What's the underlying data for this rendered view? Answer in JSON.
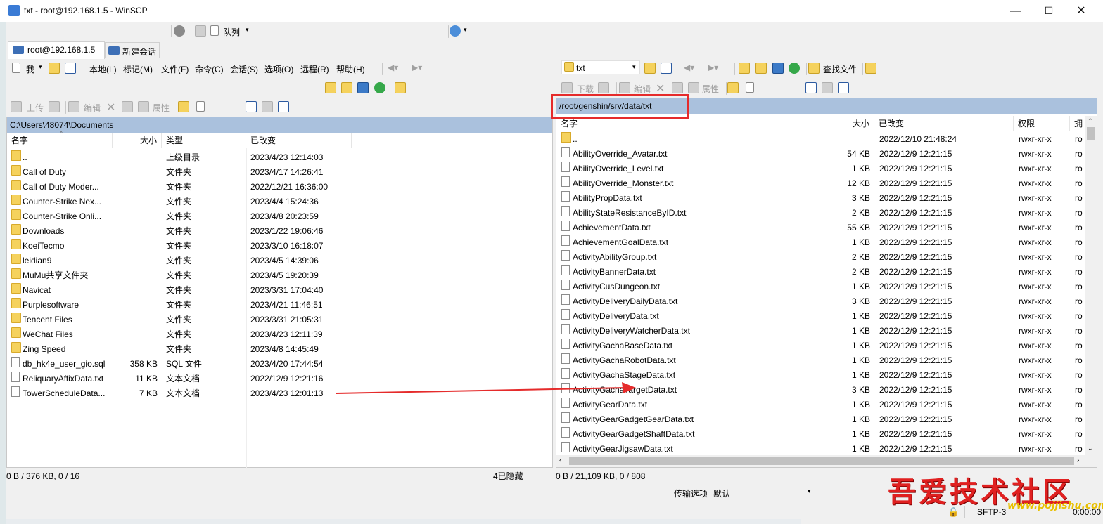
{
  "window": {
    "title": "txt - root@192.168.1.5 - WinSCP",
    "minimize": "—",
    "maximize": "☐",
    "close": "✕"
  },
  "top_toolbar": {
    "queue_label": "队列"
  },
  "tabs": [
    {
      "label": "root@192.168.1.5"
    },
    {
      "label": "新建会话"
    }
  ],
  "menu": {
    "local_dropdown": "我",
    "items": [
      "本地(L)",
      "标记(M)",
      "文件(F)",
      "命令(C)",
      "会话(S)",
      "选项(O)",
      "远程(R)",
      "帮助(H)"
    ]
  },
  "left_panel": {
    "actions": {
      "upload": "上传",
      "edit": "编辑",
      "properties": "属性"
    },
    "path": "C:\\Users\\48074\\Documents",
    "columns": [
      "名字",
      "大小",
      "类型",
      "已改变"
    ],
    "files": [
      {
        "name": "..",
        "size": "",
        "type": "上级目录",
        "modified": "2023/4/23  12:14:03",
        "icon": "up"
      },
      {
        "name": "Call of Duty",
        "size": "",
        "type": "文件夹",
        "modified": "2023/4/17  14:26:41",
        "icon": "folder"
      },
      {
        "name": "Call of Duty Moder...",
        "size": "",
        "type": "文件夹",
        "modified": "2022/12/21  16:36:00",
        "icon": "folder"
      },
      {
        "name": "Counter-Strike Nex...",
        "size": "",
        "type": "文件夹",
        "modified": "2023/4/4  15:24:36",
        "icon": "folder"
      },
      {
        "name": "Counter-Strike Onli...",
        "size": "",
        "type": "文件夹",
        "modified": "2023/4/8  20:23:59",
        "icon": "folder"
      },
      {
        "name": "Downloads",
        "size": "",
        "type": "文件夹",
        "modified": "2023/1/22  19:06:46",
        "icon": "folder"
      },
      {
        "name": "KoeiTecmo",
        "size": "",
        "type": "文件夹",
        "modified": "2023/3/10  16:18:07",
        "icon": "folder"
      },
      {
        "name": "leidian9",
        "size": "",
        "type": "文件夹",
        "modified": "2023/4/5  14:39:06",
        "icon": "folder"
      },
      {
        "name": "MuMu共享文件夹",
        "size": "",
        "type": "文件夹",
        "modified": "2023/4/5  19:20:39",
        "icon": "folder"
      },
      {
        "name": "Navicat",
        "size": "",
        "type": "文件夹",
        "modified": "2023/3/31  17:04:40",
        "icon": "folder"
      },
      {
        "name": "Purplesoftware",
        "size": "",
        "type": "文件夹",
        "modified": "2023/4/21  11:46:51",
        "icon": "folder"
      },
      {
        "name": "Tencent Files",
        "size": "",
        "type": "文件夹",
        "modified": "2023/3/31  21:05:31",
        "icon": "folder"
      },
      {
        "name": "WeChat Files",
        "size": "",
        "type": "文件夹",
        "modified": "2023/4/23  12:11:39",
        "icon": "folder"
      },
      {
        "name": "Zing Speed",
        "size": "",
        "type": "文件夹",
        "modified": "2023/4/8  14:45:49",
        "icon": "folder"
      },
      {
        "name": "db_hk4e_user_gio.sql",
        "size": "358 KB",
        "type": "SQL 文件",
        "modified": "2023/4/20  17:44:54",
        "icon": "doc"
      },
      {
        "name": "ReliquaryAffixData.txt",
        "size": "11 KB",
        "type": "文本文档",
        "modified": "2022/12/9  12:21:16",
        "icon": "doc"
      },
      {
        "name": "TowerScheduleData...",
        "size": "7 KB",
        "type": "文本文档",
        "modified": "2023/4/23  12:01:13",
        "icon": "doc"
      }
    ],
    "status": "0 B / 376 KB,  0 / 16",
    "hidden": "4已隐藏"
  },
  "right_panel": {
    "dir_dropdown": "txt",
    "find_files": "查找文件",
    "actions": {
      "download": "下载",
      "edit": "编辑",
      "properties": "属性"
    },
    "path": "/root/genshin/srv/data/txt",
    "columns": [
      "名字",
      "大小",
      "已改变",
      "权限",
      "拥"
    ],
    "files": [
      {
        "name": "..",
        "size": "",
        "modified": "2022/12/10 21:48:24",
        "perm": "rwxr-xr-x",
        "owner": "ro",
        "icon": "up"
      },
      {
        "name": "AbilityOverride_Avatar.txt",
        "size": "54 KB",
        "modified": "2022/12/9 12:21:15",
        "perm": "rwxr-xr-x",
        "owner": "ro",
        "icon": "doc"
      },
      {
        "name": "AbilityOverride_Level.txt",
        "size": "1 KB",
        "modified": "2022/12/9 12:21:15",
        "perm": "rwxr-xr-x",
        "owner": "ro",
        "icon": "doc"
      },
      {
        "name": "AbilityOverride_Monster.txt",
        "size": "12 KB",
        "modified": "2022/12/9 12:21:15",
        "perm": "rwxr-xr-x",
        "owner": "ro",
        "icon": "doc"
      },
      {
        "name": "AbilityPropData.txt",
        "size": "3 KB",
        "modified": "2022/12/9 12:21:15",
        "perm": "rwxr-xr-x",
        "owner": "ro",
        "icon": "doc"
      },
      {
        "name": "AbilityStateResistanceByID.txt",
        "size": "2 KB",
        "modified": "2022/12/9 12:21:15",
        "perm": "rwxr-xr-x",
        "owner": "ro",
        "icon": "doc"
      },
      {
        "name": "AchievementData.txt",
        "size": "55 KB",
        "modified": "2022/12/9 12:21:15",
        "perm": "rwxr-xr-x",
        "owner": "ro",
        "icon": "doc"
      },
      {
        "name": "AchievementGoalData.txt",
        "size": "1 KB",
        "modified": "2022/12/9 12:21:15",
        "perm": "rwxr-xr-x",
        "owner": "ro",
        "icon": "doc"
      },
      {
        "name": "ActivityAbilityGroup.txt",
        "size": "2 KB",
        "modified": "2022/12/9 12:21:15",
        "perm": "rwxr-xr-x",
        "owner": "ro",
        "icon": "doc"
      },
      {
        "name": "ActivityBannerData.txt",
        "size": "2 KB",
        "modified": "2022/12/9 12:21:15",
        "perm": "rwxr-xr-x",
        "owner": "ro",
        "icon": "doc"
      },
      {
        "name": "ActivityCusDungeon.txt",
        "size": "1 KB",
        "modified": "2022/12/9 12:21:15",
        "perm": "rwxr-xr-x",
        "owner": "ro",
        "icon": "doc"
      },
      {
        "name": "ActivityDeliveryDailyData.txt",
        "size": "3 KB",
        "modified": "2022/12/9 12:21:15",
        "perm": "rwxr-xr-x",
        "owner": "ro",
        "icon": "doc"
      },
      {
        "name": "ActivityDeliveryData.txt",
        "size": "1 KB",
        "modified": "2022/12/9 12:21:15",
        "perm": "rwxr-xr-x",
        "owner": "ro",
        "icon": "doc"
      },
      {
        "name": "ActivityDeliveryWatcherData.txt",
        "size": "1 KB",
        "modified": "2022/12/9 12:21:15",
        "perm": "rwxr-xr-x",
        "owner": "ro",
        "icon": "doc"
      },
      {
        "name": "ActivityGachaBaseData.txt",
        "size": "1 KB",
        "modified": "2022/12/9 12:21:15",
        "perm": "rwxr-xr-x",
        "owner": "ro",
        "icon": "doc"
      },
      {
        "name": "ActivityGachaRobotData.txt",
        "size": "1 KB",
        "modified": "2022/12/9 12:21:15",
        "perm": "rwxr-xr-x",
        "owner": "ro",
        "icon": "doc"
      },
      {
        "name": "ActivityGachaStageData.txt",
        "size": "1 KB",
        "modified": "2022/12/9 12:21:15",
        "perm": "rwxr-xr-x",
        "owner": "ro",
        "icon": "doc"
      },
      {
        "name": "ActivityGachaTargetData.txt",
        "size": "3 KB",
        "modified": "2022/12/9 12:21:15",
        "perm": "rwxr-xr-x",
        "owner": "ro",
        "icon": "doc"
      },
      {
        "name": "ActivityGearData.txt",
        "size": "1 KB",
        "modified": "2022/12/9 12:21:15",
        "perm": "rwxr-xr-x",
        "owner": "ro",
        "icon": "doc"
      },
      {
        "name": "ActivityGearGadgetGearData.txt",
        "size": "1 KB",
        "modified": "2022/12/9 12:21:15",
        "perm": "rwxr-xr-x",
        "owner": "ro",
        "icon": "doc"
      },
      {
        "name": "ActivityGearGadgetShaftData.txt",
        "size": "1 KB",
        "modified": "2022/12/9 12:21:15",
        "perm": "rwxr-xr-x",
        "owner": "ro",
        "icon": "doc"
      },
      {
        "name": "ActivityGearJigsawData.txt",
        "size": "1 KB",
        "modified": "2022/12/9 12:21:15",
        "perm": "rwxr-xr-x",
        "owner": "ro",
        "icon": "doc"
      }
    ],
    "status": "0 B / 21,109 KB,  0 / 808"
  },
  "transfer": {
    "label": "传输选项",
    "value": "默认"
  },
  "bottom_status": {
    "protocol": "SFTP-3",
    "timer": "0:00:00"
  },
  "watermark": {
    "text": "吾爱技术社区",
    "url": "www.pojjishu.com"
  },
  "colors": {
    "path_bar": "#aac1dd",
    "highlight_box": "#e52b2b",
    "arrow": "#e52b2b"
  }
}
